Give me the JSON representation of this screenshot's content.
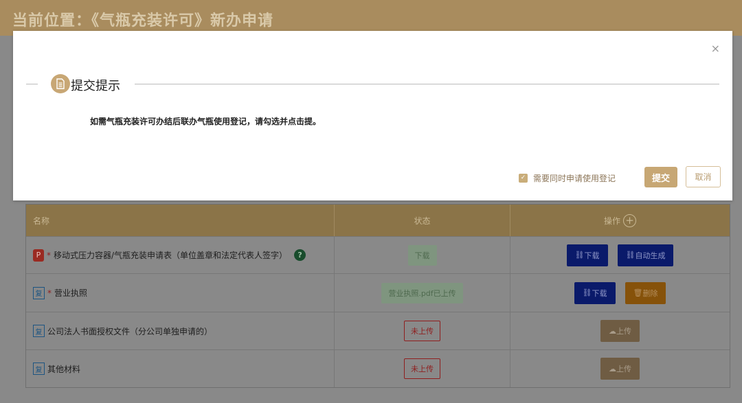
{
  "page": {
    "title": "当前位置：《气瓶充装许可》新办申请"
  },
  "dialog": {
    "heading": "提交提示",
    "message": "如需气瓶充装许可办结后联办气瓶使用登记，请勾选并点击提。",
    "checkbox_label": "需要同时申请使用登记",
    "checkbox_checked": true,
    "submit_label": "提交",
    "cancel_label": "取消",
    "close_glyph": "×",
    "icon": "document-icon"
  },
  "table": {
    "headers": {
      "name": "名称",
      "status": "状态",
      "action": "操作"
    },
    "add_glyph": "+",
    "rows": [
      {
        "icon_text": "P",
        "required": "*",
        "name": "移动式压力容器/气瓶充装申请表（单位盖章和法定代表人签字）",
        "help": "?",
        "status": "下载",
        "status_style": "green",
        "actions": [
          "下载",
          "自动生成"
        ]
      },
      {
        "icon_text": "复",
        "required": "*",
        "name": "营业执照",
        "status": "营业执照.pdf已上传",
        "status_style": "green",
        "actions": [
          "下载",
          "删除"
        ]
      },
      {
        "icon_text": "复",
        "required": "",
        "name": "公司法人书面授权文件（分公司单独申请的）",
        "status": "未上传",
        "status_style": "red",
        "actions": [
          "上传"
        ]
      },
      {
        "icon_text": "复",
        "required": "",
        "name": "其他材料",
        "status": "未上传",
        "status_style": "red",
        "actions": [
          "上传"
        ]
      }
    ]
  },
  "colors": {
    "accent": "#c7a774",
    "header_bar": "#a98c5e",
    "required": "#8f1e1e",
    "button_blue": "#0a1a6a",
    "button_orange": "#86520a"
  }
}
